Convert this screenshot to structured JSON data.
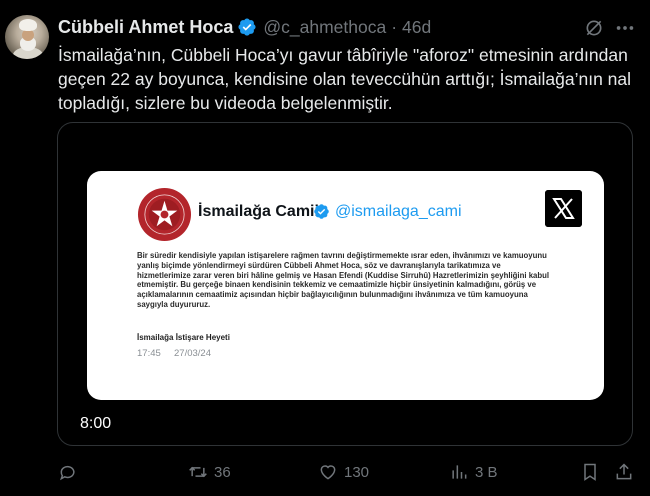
{
  "post": {
    "author_name": "Cübbeli Ahmet Hoca",
    "handle": "@c_ahmethoca",
    "separator": "·",
    "age": "46d",
    "text": "İsmailağa’nın, Cübbeli Hoca’yı gavur tâbîriyle \"aforoz\" etmesinin ardından geçen 22 ay boyunca, kendisine olan teveccühün arttığı; İsmailağa’nın nal topladığı, sizlere bu videoda belgelenmiştir."
  },
  "media": {
    "duration": "8:00",
    "card": {
      "account_name": "İsmailağa Camii",
      "account_handle": "@ismailaga_cami",
      "statement": "Bir süredir kendisiyle yapılan istişarelere rağmen tavrını değiştirmemekte ısrar eden, ihvânımızı ve kamuoyunu yanlış biçimde yönlendirmeyi sürdüren Cübbeli Ahmet Hoca, söz ve davranışlarıyla tarikatımıza ve hizmetlerimize zarar veren biri hâline gelmiş ve Hasan Efendi (Kuddise Sirruhû) Hazretlerimizin şeyhliğini kabul etmemiştir. Bu gerçeğe binaen kendisinin tekkemiz ve cemaatimizle hiçbir ünsiyetinin kalmadığını, görüş ve açıklamalarının cemaatimiz açısından hiçbir bağlayıcılığının bulunmadığını ihvânımıza ve tüm kamuoyuna saygıyla duyururuz.",
      "signature": "İsmailağa İstişare Heyeti",
      "time": "17:45",
      "date": "27/03/24"
    }
  },
  "actions": {
    "reposts": "36",
    "likes": "130",
    "views": "3 B"
  },
  "colors": {
    "background": "#000000",
    "text": "#e7e9ea",
    "muted": "#71767b",
    "verified": "#1d9bf0",
    "logo_red": "#b3252b"
  }
}
